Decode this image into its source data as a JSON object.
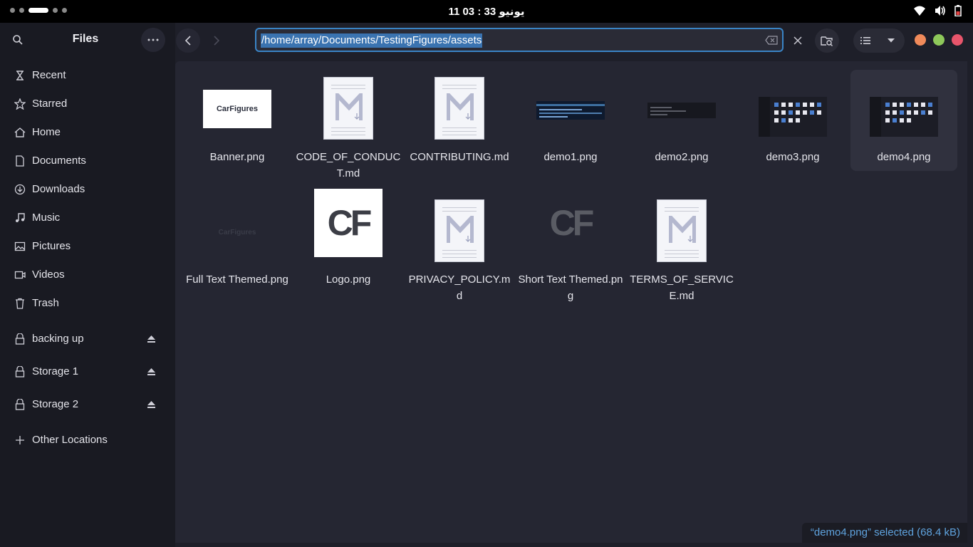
{
  "topbar": {
    "clock": "11 يونيو 33 : 03",
    "icons": [
      "wifi-icon",
      "volume-icon",
      "battery-icon"
    ]
  },
  "sidebar": {
    "title": "Files",
    "places": [
      {
        "label": "Recent",
        "icon": "clock-icon"
      },
      {
        "label": "Starred",
        "icon": "star-icon"
      },
      {
        "label": "Home",
        "icon": "home-icon"
      },
      {
        "label": "Documents",
        "icon": "document-icon"
      },
      {
        "label": "Downloads",
        "icon": "download-icon"
      },
      {
        "label": "Music",
        "icon": "music-icon"
      },
      {
        "label": "Pictures",
        "icon": "picture-icon"
      },
      {
        "label": "Videos",
        "icon": "video-icon"
      },
      {
        "label": "Trash",
        "icon": "trash-icon"
      }
    ],
    "drives": [
      {
        "label": "backing up",
        "icon": "drive-icon"
      },
      {
        "label": "Storage 1",
        "icon": "drive-icon"
      },
      {
        "label": "Storage 2",
        "icon": "drive-icon"
      }
    ],
    "other_locations": "Other Locations"
  },
  "header": {
    "path": "/home/array/Documents/TestingFigures/assets"
  },
  "files": [
    {
      "name": "Banner.png",
      "kind": "banner"
    },
    {
      "name": "CODE_OF_CONDUCT.md",
      "kind": "md"
    },
    {
      "name": "CONTRIBUTING.md",
      "kind": "md"
    },
    {
      "name": "demo1.png",
      "kind": "demo1"
    },
    {
      "name": "demo2.png",
      "kind": "demo2"
    },
    {
      "name": "demo3.png",
      "kind": "demo3"
    },
    {
      "name": "demo4.png",
      "kind": "demo3",
      "selected": true
    },
    {
      "name": "Full Text Themed.png",
      "kind": "fulltext"
    },
    {
      "name": "Logo.png",
      "kind": "logo"
    },
    {
      "name": "PRIVACY_POLICY.md",
      "kind": "md"
    },
    {
      "name": "Short Text Themed.png",
      "kind": "shorttext"
    },
    {
      "name": "TERMS_OF_SERVICE.md",
      "kind": "md"
    }
  ],
  "thumb_text": {
    "banner": "CarFigures",
    "logo": "CF"
  },
  "status": "“demo4.png” selected  (68.4 kB)",
  "colors": {
    "accent": "#3a84c6",
    "selection_text": "#5fa3de",
    "close": "#e8556b",
    "maximize": "#8ec85a",
    "minimize": "#f08a5a"
  }
}
